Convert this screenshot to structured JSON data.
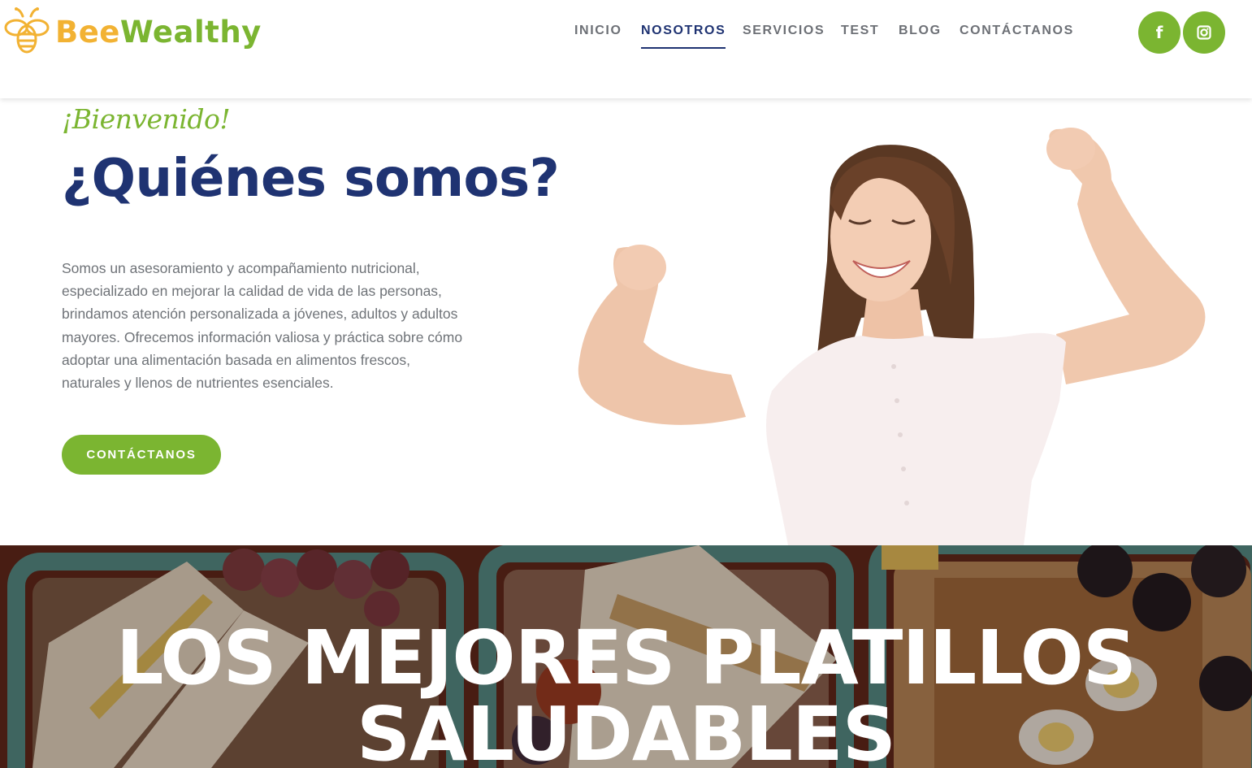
{
  "brand": {
    "name_part1": "Bee",
    "name_part2": "Wealthy",
    "colors": {
      "green": "#7bb531",
      "gold": "#f2b233",
      "navy": "#1f3372"
    }
  },
  "nav": {
    "items": [
      {
        "label": "INICIO",
        "active": false
      },
      {
        "label": "NOSOTROS",
        "active": true
      },
      {
        "label": "SERVICIOS",
        "active": false
      },
      {
        "label": "TEST",
        "active": false
      },
      {
        "label": "BLOG",
        "active": false
      },
      {
        "label": "CONTÁCTANOS",
        "active": false
      }
    ]
  },
  "social": {
    "facebook": {
      "icon": "facebook-icon",
      "glyph": "f"
    },
    "instagram": {
      "icon": "instagram-icon"
    }
  },
  "hero": {
    "welcome": "¡Bienvenido!",
    "title": "¿Quiénes somos?",
    "description": "Somos un asesoramiento y acompañamiento nutricional, especializado en mejorar la calidad de vida de las personas, brindamos atención personalizada a jóvenes, adultos y adultos mayores. Ofrecemos información valiosa y práctica sobre cómo adoptar una alimentación basada en alimentos frescos, naturales y llenos de nutrientes esenciales.",
    "cta_label": "CONTÁCTANOS"
  },
  "banner": {
    "line1": "LOS MEJORES PLATILLOS",
    "line2": "SALUDABLES"
  }
}
